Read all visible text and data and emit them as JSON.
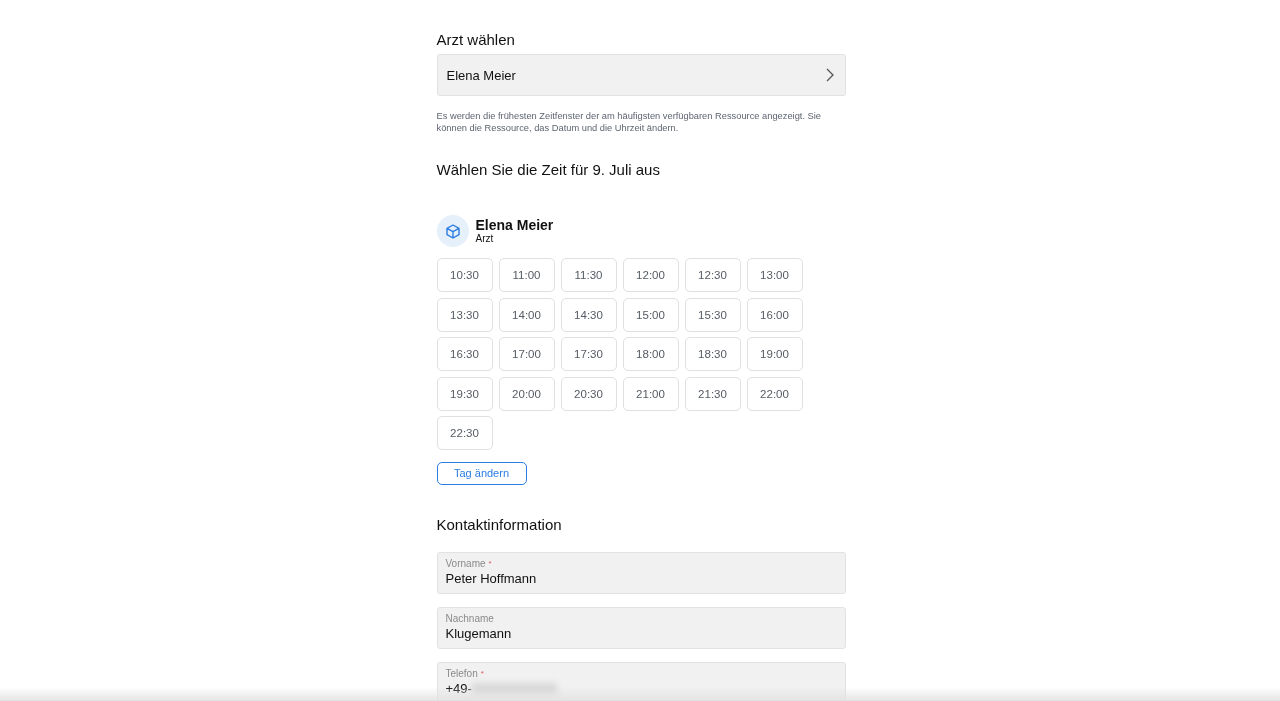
{
  "doctor_section": {
    "title": "Arzt wählen",
    "value": "Elena Meier"
  },
  "note": "Es werden die frühesten Zeitfenster der am häufigsten verfügbaren Ressource angezeigt. Sie können die Ressource, das Datum und die Uhrzeit ändern.",
  "time_heading": "Wählen Sie die Zeit für 9. Juli aus",
  "resource": {
    "name": "Elena Meier",
    "role": "Arzt"
  },
  "slots": [
    {
      "label": "10:30",
      "selected": false
    },
    {
      "label": "11:00",
      "selected": false
    },
    {
      "label": "11:30",
      "selected": false
    },
    {
      "label": "12:00",
      "selected": false
    },
    {
      "label": "12:30",
      "selected": false
    },
    {
      "label": "13:00",
      "selected": false
    },
    {
      "label": "13:30",
      "selected": false
    },
    {
      "label": "14:00",
      "selected": false
    },
    {
      "label": "14:30",
      "selected": false
    },
    {
      "label": "15:00",
      "selected": false
    },
    {
      "label": "15:30",
      "selected": false
    },
    {
      "label": "16:00",
      "selected": false
    },
    {
      "label": "16:30",
      "selected": false
    },
    {
      "label": "17:00",
      "selected": false
    },
    {
      "label": "17:30",
      "selected": false
    },
    {
      "label": "18:00",
      "selected": false
    },
    {
      "label": "18:30",
      "selected": false
    },
    {
      "label": "19:00",
      "selected": false
    },
    {
      "label": "19:30",
      "selected": false
    },
    {
      "label": "20:00",
      "selected": false
    },
    {
      "label": "20:30",
      "selected": false
    },
    {
      "label": "21:00",
      "selected": false
    },
    {
      "label": "21:30",
      "selected": false
    },
    {
      "label": "22:00",
      "selected": false
    },
    {
      "label": "22:30",
      "selected": false
    }
  ],
  "change_day_button": "Tag ändern",
  "contact": {
    "title": "Kontaktinformation",
    "fields": [
      {
        "label": "Vorname",
        "required_mark": "*",
        "value": "Peter Hoffmann",
        "redacted": false
      },
      {
        "label": "Nachname",
        "value": "Klugemann",
        "redacted": false
      },
      {
        "label": "Telefon",
        "required_mark": "*",
        "value": "+49-",
        "redacted": true
      }
    ]
  }
}
